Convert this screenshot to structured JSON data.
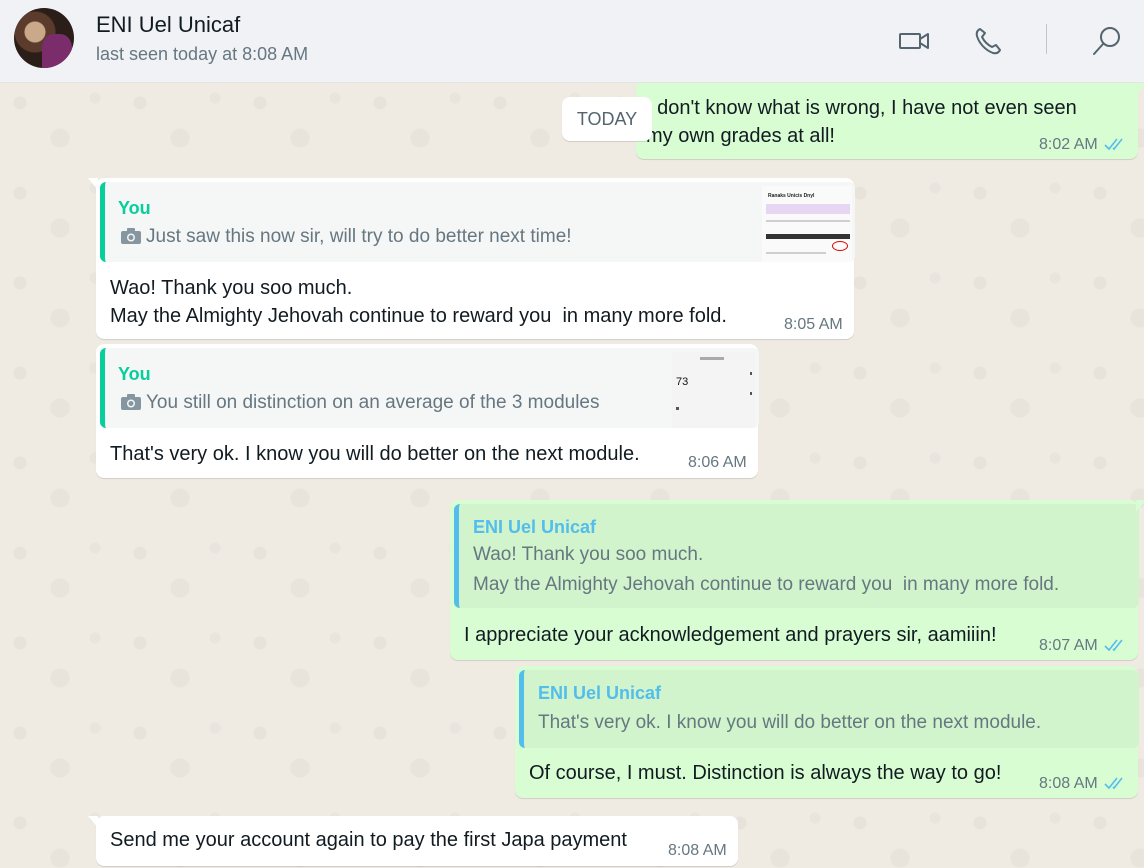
{
  "header": {
    "contact_name": "ENI Uel Unicaf",
    "last_seen": "last seen today at 8:08 AM"
  },
  "date_chip": "TODAY",
  "messages": [
    {
      "direction": "outgoing",
      "lines": [
        "I don't know what is wrong, I have not even seen",
        "my own grades at all!"
      ],
      "time": "8:02 AM"
    },
    {
      "direction": "incoming",
      "quote": {
        "author": "You",
        "text": "Just saw this now sir, will try to do better next time!",
        "thumb_title": "Ranaks Unicis Dnyl"
      },
      "lines": [
        "Wao! Thank you soo much.",
        "May the Almighty Jehovah continue to reward you  in many more fold."
      ],
      "time": "8:05 AM"
    },
    {
      "direction": "incoming",
      "quote": {
        "author": "You",
        "text": "You still on distinction on an average of the 3 modules",
        "thumb_value": "73"
      },
      "lines": [
        "That's very ok. I know you will do better on the next module."
      ],
      "time": "8:06 AM"
    },
    {
      "direction": "outgoing",
      "quote": {
        "author": "ENI Uel Unicaf",
        "lines": [
          "Wao! Thank you soo much.",
          "May the Almighty Jehovah continue to reward you  in many more fold."
        ]
      },
      "lines": [
        "I appreciate your acknowledgement and prayers sir, aamiiin!"
      ],
      "time": "8:07 AM"
    },
    {
      "direction": "outgoing",
      "quote": {
        "author": "ENI Uel Unicaf",
        "lines": [
          "That's very ok. I know you will do better on the next module."
        ]
      },
      "lines": [
        "Of course, I must. Distinction is always the way to go!"
      ],
      "time": "8:08 AM"
    },
    {
      "direction": "incoming",
      "lines": [
        "Send me your account again to pay the first Japa payment"
      ],
      "time": "8:08 AM"
    }
  ],
  "colors": {
    "incoming_bubble": "#ffffff",
    "outgoing_bubble": "#d9fdd3",
    "quote_author_you": "#06cf9c",
    "quote_author_contact": "#53bdeb",
    "read_ticks": "#53bdeb"
  },
  "icons": [
    "video-call-icon",
    "voice-call-icon",
    "search-icon",
    "camera-icon",
    "double-check-icon"
  ]
}
